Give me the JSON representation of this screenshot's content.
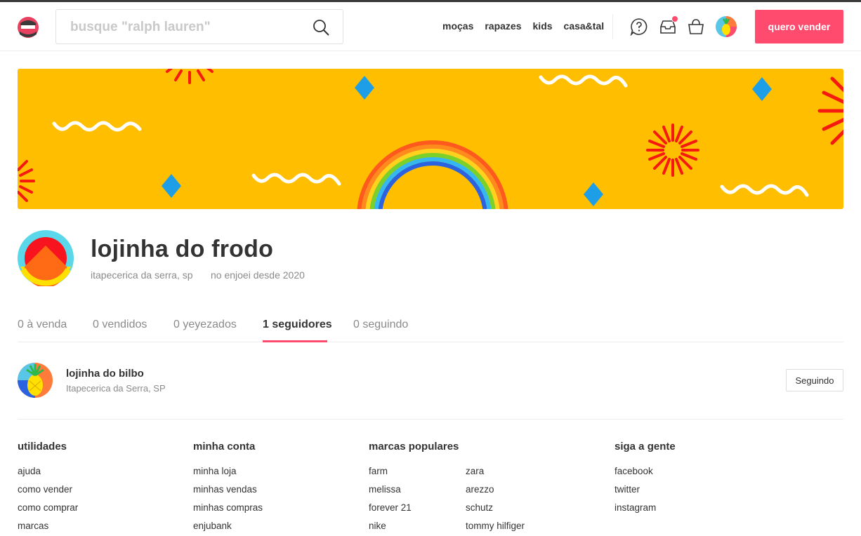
{
  "header": {
    "search_placeholder": "busque \"ralph lauren\"",
    "nav": [
      "moças",
      "rapazes",
      "kids",
      "casa&tal"
    ],
    "sell_button": "quero vender",
    "icons": [
      "help-icon",
      "inbox-icon",
      "bag-icon",
      "user-avatar"
    ]
  },
  "profile": {
    "name": "lojinha do frodo",
    "location": "itapecerica da serra, sp",
    "since": "no enjoei desde 2020"
  },
  "tabs": [
    {
      "label": "0 à venda",
      "active": false
    },
    {
      "label": "0 vendidos",
      "active": false
    },
    {
      "label": "0 yeyezados",
      "active": false
    },
    {
      "label": "1 seguidores",
      "active": true
    },
    {
      "label": "0 seguindo",
      "active": false
    }
  ],
  "follower": {
    "name": "lojinha do bilbo",
    "location": "Itapecerica da Serra, SP",
    "button": "Seguindo"
  },
  "footer": {
    "utilidades": {
      "title": "utilidades",
      "links": [
        "ajuda",
        "como vender",
        "como comprar",
        "marcas"
      ]
    },
    "minha_conta": {
      "title": "minha conta",
      "links": [
        "minha loja",
        "minhas vendas",
        "minhas compras",
        "enjubank"
      ]
    },
    "marcas": {
      "title": "marcas populares",
      "col1": [
        "farm",
        "melissa",
        "forever 21",
        "nike"
      ],
      "col2": [
        "zara",
        "arezzo",
        "schutz",
        "tommy hilfiger"
      ]
    },
    "siga": {
      "title": "siga a gente",
      "links": [
        "facebook",
        "twitter",
        "instagram"
      ]
    }
  },
  "colors": {
    "accent": "#ff4b6e",
    "banner": "#ffbf00"
  }
}
